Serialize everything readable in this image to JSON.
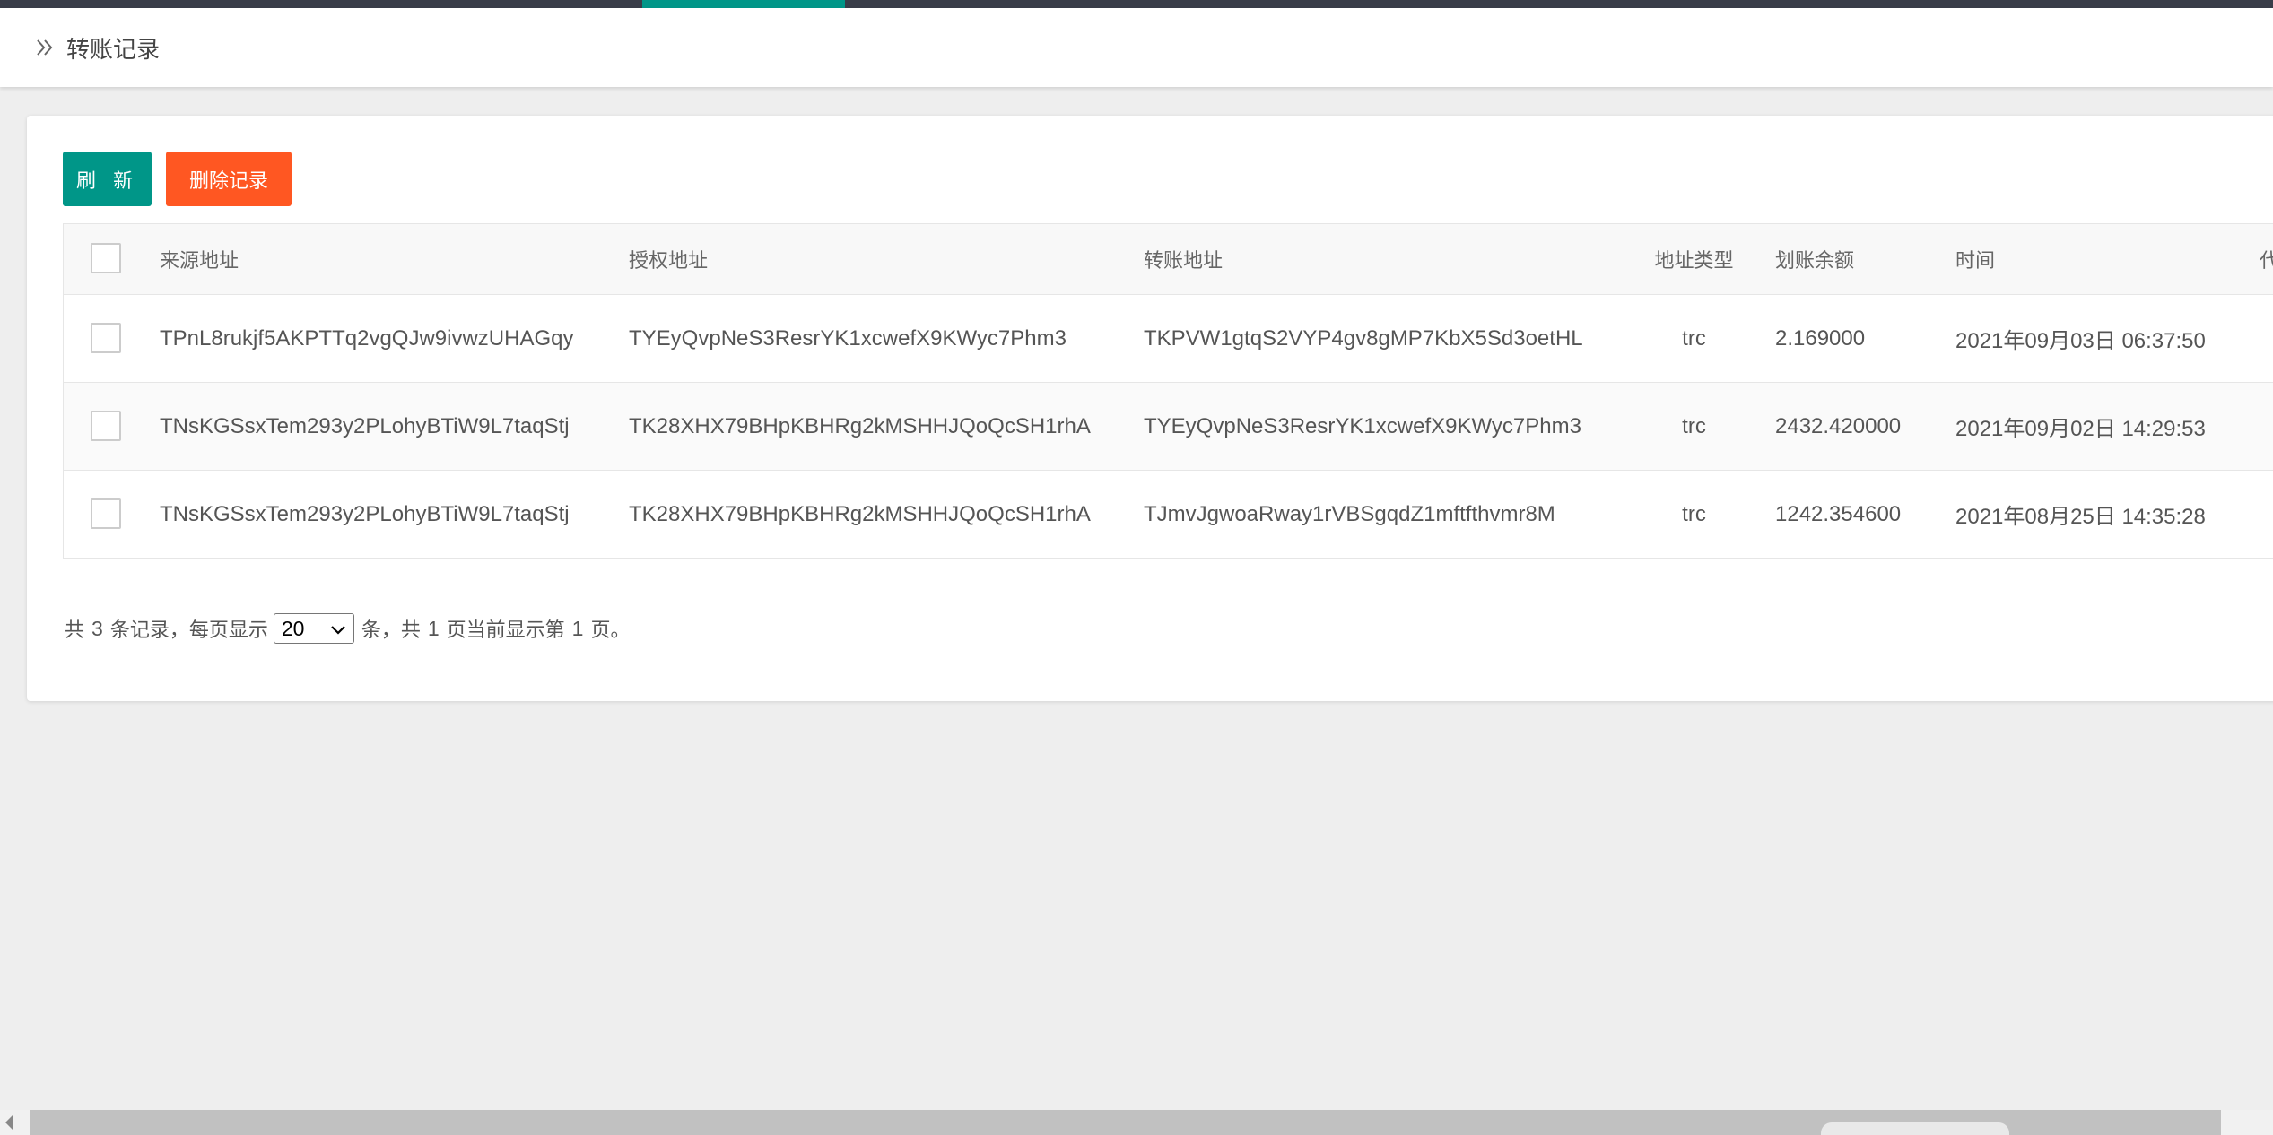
{
  "header": {
    "title": "转账记录"
  },
  "toolbar": {
    "refresh_label": "刷 新",
    "delete_label": "删除记录"
  },
  "table": {
    "columns": [
      "来源地址",
      "授权地址",
      "转账地址",
      "地址类型",
      "划账余额",
      "时间",
      "代"
    ],
    "rows": [
      {
        "source": "TPnL8rukjf5AKPTTq2vgQJw9ivwzUHAGqy",
        "auth": "TYEyQvpNeS3ResrYK1xcwefX9KWyc7Phm3",
        "target": "TKPVW1gtqS2VYP4gv8gMP7KbX5Sd3oetHL",
        "type": "trc",
        "amount": "2.169000",
        "time": "2021年09月03日 06:37:50"
      },
      {
        "source": "TNsKGSsxTem293y2PLohyBTiW9L7taqStj",
        "auth": "TK28XHX79BHpKBHRg2kMSHHJQoQcSH1rhA",
        "target": "TYEyQvpNeS3ResrYK1xcwefX9KWyc7Phm3",
        "type": "trc",
        "amount": "2432.420000",
        "time": "2021年09月02日 14:29:53"
      },
      {
        "source": "TNsKGSsxTem293y2PLohyBTiW9L7taqStj",
        "auth": "TK28XHX79BHpKBHRg2kMSHHJQoQcSH1rhA",
        "target": "TJmvJgwoaRway1rVBSgqdZ1mftfthvmr8M",
        "type": "trc",
        "amount": "1242.354600",
        "time": "2021年08月25日 14:35:28"
      }
    ]
  },
  "pager": {
    "prefix": "共",
    "total": "3",
    "mid1": "条记录，每页显示",
    "per_page": "20",
    "mid2": "条，共",
    "pages": "1",
    "mid3": "页当前显示第",
    "current": "1",
    "suffix": "页。"
  },
  "icons": {
    "breadcrumb": "double-chevron-right-icon",
    "dropdown": "chevron-down-icon"
  },
  "colors": {
    "primary": "#009688",
    "danger": "#ff5722",
    "topbar": "#393d49"
  }
}
